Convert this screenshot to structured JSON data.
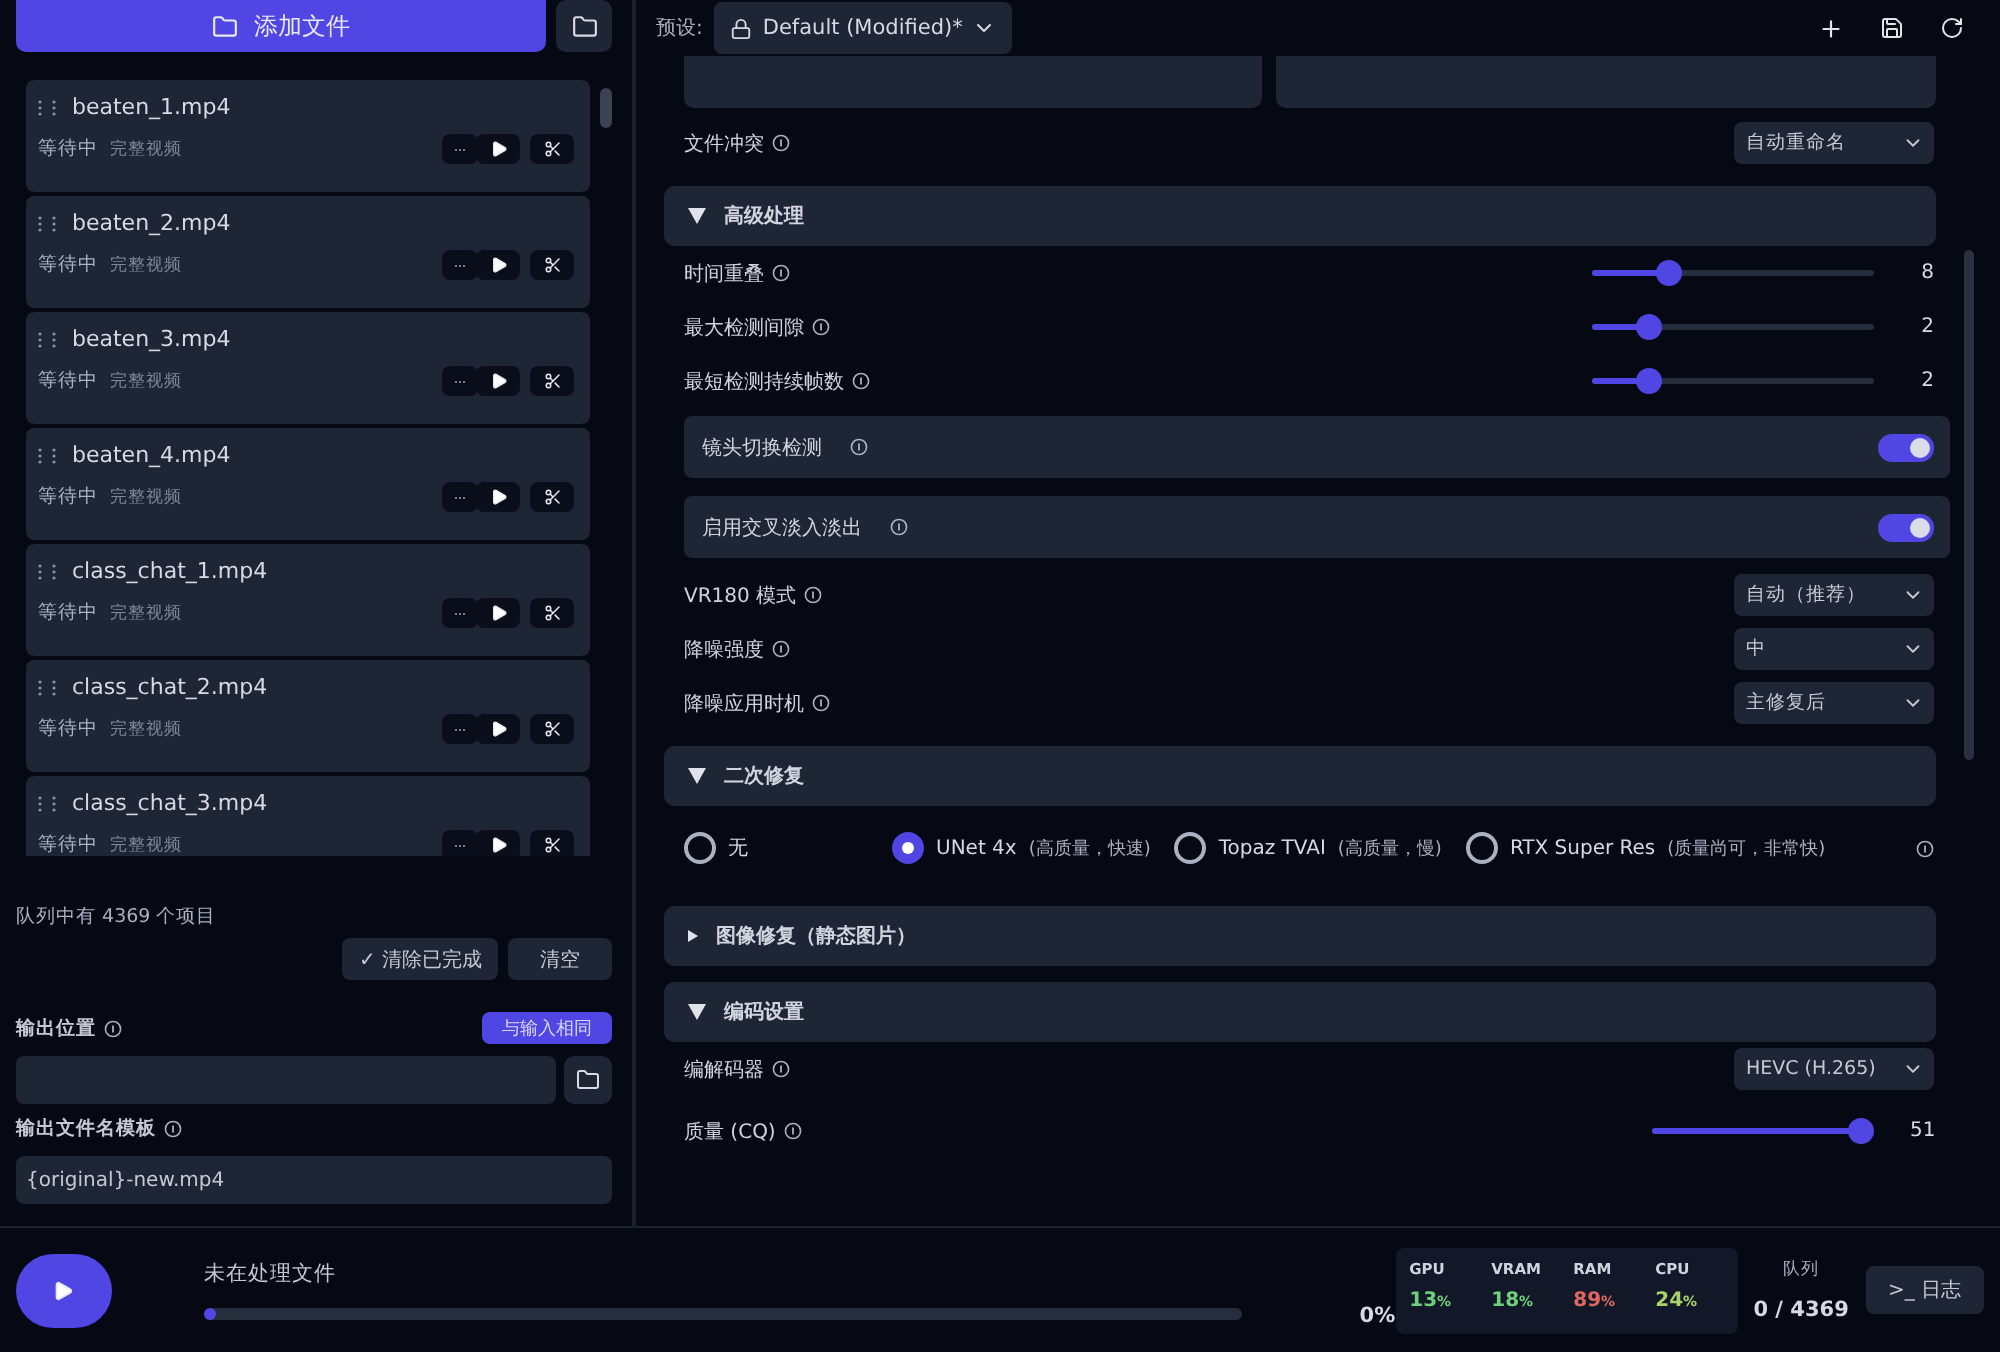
{
  "left_panel": {
    "add_files_button": "添加文件",
    "queue": [
      {
        "name": "beaten_1.mp4",
        "status": "等待中",
        "mode": "完整视频"
      },
      {
        "name": "beaten_2.mp4",
        "status": "等待中",
        "mode": "完整视频"
      },
      {
        "name": "beaten_3.mp4",
        "status": "等待中",
        "mode": "完整视频"
      },
      {
        "name": "beaten_4.mp4",
        "status": "等待中",
        "mode": "完整视频"
      },
      {
        "name": "class_chat_1.mp4",
        "status": "等待中",
        "mode": "完整视频"
      },
      {
        "name": "class_chat_2.mp4",
        "status": "等待中",
        "mode": "完整视频"
      },
      {
        "name": "class_chat_3.mp4",
        "status": "等待中",
        "mode": "完整视频"
      }
    ],
    "queue_count": "队列中有 4369 个项目",
    "clear_done_button": "✓ 清除已完成",
    "clear_all_button": "清空",
    "output_location_label": "输出位置",
    "same_as_input_button": "与输入相同",
    "template_label": "输出文件名模板",
    "template_value": "{original}-new.mp4"
  },
  "preset": {
    "label": "预设:",
    "value": "Default (Modified)*"
  },
  "settings": [
    {
      "kind": "select",
      "label": "文件冲突",
      "value": "自动重命名"
    },
    {
      "kind": "section",
      "label": "高级处理",
      "expanded": true
    },
    {
      "kind": "slider",
      "label": "时间重叠",
      "level": 0.27,
      "reading": "8"
    },
    {
      "kind": "slider",
      "label": "最大检测间隙",
      "level": 0.2,
      "reading": "2"
    },
    {
      "kind": "slider",
      "label": "最短检测持续帧数",
      "level": 0.2,
      "reading": "2"
    },
    {
      "kind": "toggle",
      "label": "镜头切换检测",
      "on": true
    },
    {
      "kind": "toggle",
      "label": "启用交叉淡入淡出",
      "on": true
    },
    {
      "kind": "select",
      "label": "VR180 模式",
      "value": "自动（推荐）"
    },
    {
      "kind": "select",
      "label": "降噪强度",
      "value": "中"
    },
    {
      "kind": "select",
      "label": "降噪应用时机",
      "value": "主修复后"
    },
    {
      "kind": "section",
      "label": "二次修复",
      "expanded": true
    },
    {
      "kind": "radios",
      "options": [
        {
          "label": "无",
          "selected": false
        },
        {
          "label": "UNet 4x",
          "note": "(高质量，快速)",
          "selected": true
        },
        {
          "label": "Topaz TVAI",
          "note": "(高质量，慢)",
          "selected": false
        },
        {
          "label": "RTX Super Res",
          "note": "(质量尚可，非常快)",
          "selected": false
        }
      ]
    },
    {
      "kind": "section",
      "label": "图像修复（静态图片）",
      "expanded": false
    },
    {
      "kind": "section",
      "label": "编码设置",
      "expanded": true
    },
    {
      "kind": "select",
      "label": "编解码器",
      "value": "HEVC (H.265)"
    },
    {
      "kind": "slider",
      "label": "质量 (CQ)",
      "level": 0.98,
      "reading": "51"
    }
  ],
  "status_bar": {
    "status": "未在处理文件",
    "progress": {
      "level": 0.0,
      "reading": "0%"
    },
    "stats": [
      {
        "name": "GPU",
        "value": "13",
        "unit": "%",
        "color": "#6fcf7a"
      },
      {
        "name": "VRAM",
        "value": "18",
        "unit": "%",
        "color": "#6fcf7a"
      },
      {
        "name": "RAM",
        "value": "89",
        "unit": "%",
        "color": "#e0675f"
      },
      {
        "name": "CPU",
        "value": "24",
        "unit": "%",
        "color": "#a9d46a"
      }
    ],
    "queue_label": "队列",
    "queue_value": "0 / 4369",
    "log_button": ">_ 日志"
  }
}
